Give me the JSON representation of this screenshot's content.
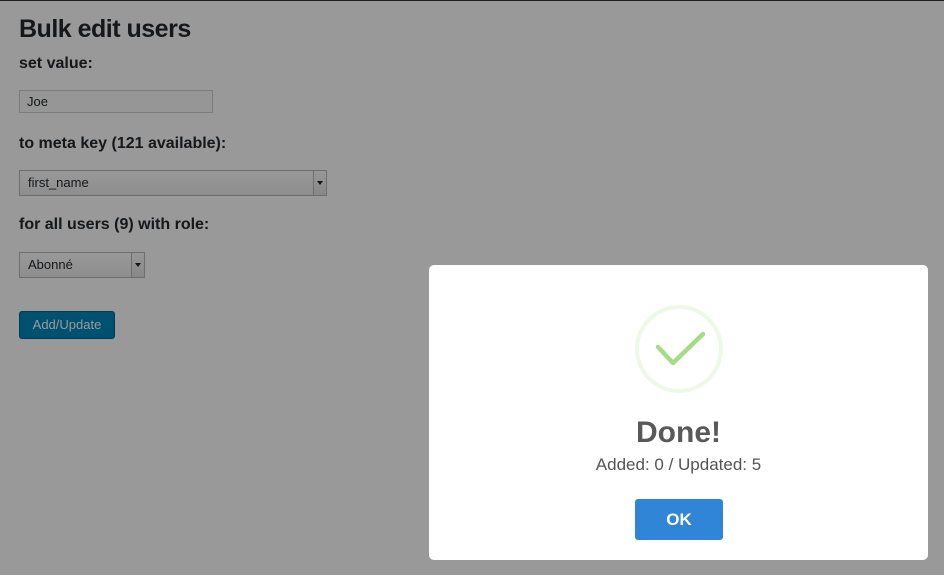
{
  "page": {
    "title": "Bulk edit users",
    "set_value_label": "set value:",
    "value_input": {
      "value": "Joe",
      "placeholder": ""
    },
    "meta_key_label": "to meta key (121 available):",
    "meta_key_select": {
      "selected": "first_name"
    },
    "role_label": "for all users (9) with role:",
    "role_select": {
      "selected": "Abonné"
    },
    "submit_label": "Add/Update"
  },
  "dialog": {
    "icon": "success-checkmark-icon",
    "title": "Done!",
    "message": "Added: 0 / Updated: 5",
    "confirm_label": "OK",
    "colors": {
      "confirm": "#3085d6",
      "check": "#a5dc86"
    }
  },
  "colors": {
    "primary_button": "#0085ba"
  }
}
